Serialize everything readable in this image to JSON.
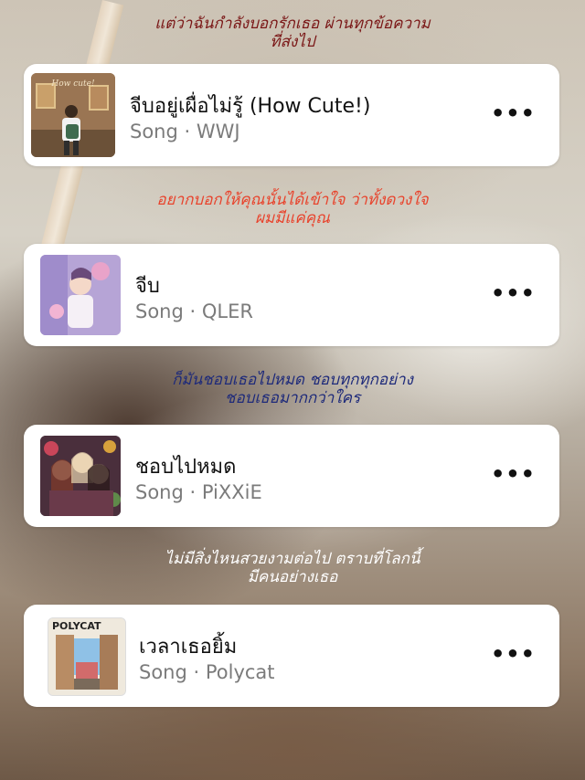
{
  "captions": [
    {
      "lines": [
        "แต่ว่าฉันกำลังบอกรักเธอ ผ่านทุกข้อความ",
        "ที่ส่งไป"
      ],
      "color": "#7a1616"
    },
    {
      "lines": [
        "อยากบอกให้คุณนั้นได้เข้าใจ ว่าทั้งดวงใจ",
        "ผมมีแค่คุณ"
      ],
      "color": "#e8432c"
    },
    {
      "lines": [
        "ก็มันชอบเธอไปหมด ชอบทุกทุกอย่าง",
        "ชอบเธอมากกว่าใคร"
      ],
      "color": "#1e2a7a"
    },
    {
      "lines": [
        "ไม่มีสิ่งไหนสวยงามต่อไป ตราบที่โลกนี้",
        "มีคนอย่างเธอ"
      ],
      "color": "#ffffff"
    }
  ],
  "songs": [
    {
      "title": "จีบอยู่เผื่อไม่รู้ (How Cute!)",
      "subtitle": "Song · WWJ",
      "cover_text": "How cute!",
      "more": "•••"
    },
    {
      "title": "จีบ",
      "subtitle": "Song · QLER",
      "more": "•••"
    },
    {
      "title": "ชอบไปหมด",
      "subtitle": "Song · PiXXiE",
      "more": "•••"
    },
    {
      "title": "เวลาเธอยิ้ม",
      "subtitle": "Song · Polycat",
      "cover_text": "POLYCAT",
      "more": "•••"
    }
  ]
}
